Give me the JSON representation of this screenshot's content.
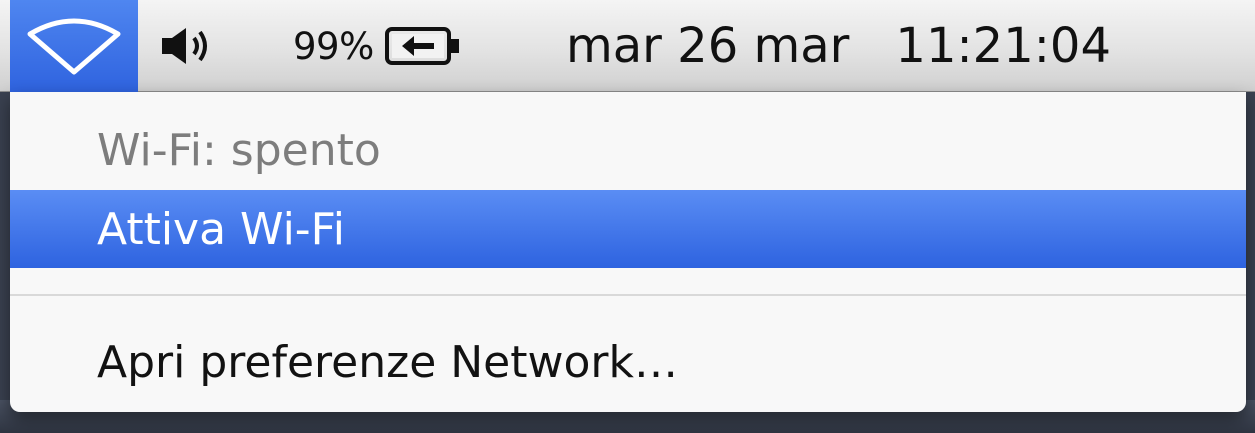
{
  "menubar": {
    "wifi_icon": "wifi-icon",
    "volume_icon": "speaker-volume-icon",
    "battery": {
      "percent": "99%",
      "icon": "battery-charging-plug-icon"
    },
    "clock": {
      "date": "mar 26 mar",
      "time": "11:21:04"
    }
  },
  "wifi_menu": {
    "status": "Wi-Fi: spento",
    "toggle_label": "Attiva Wi-Fi",
    "open_prefs_label": "Apri preferenze Network…"
  },
  "colors": {
    "highlight": "#3b6fe6",
    "disabled_text": "#7d7d7d"
  }
}
